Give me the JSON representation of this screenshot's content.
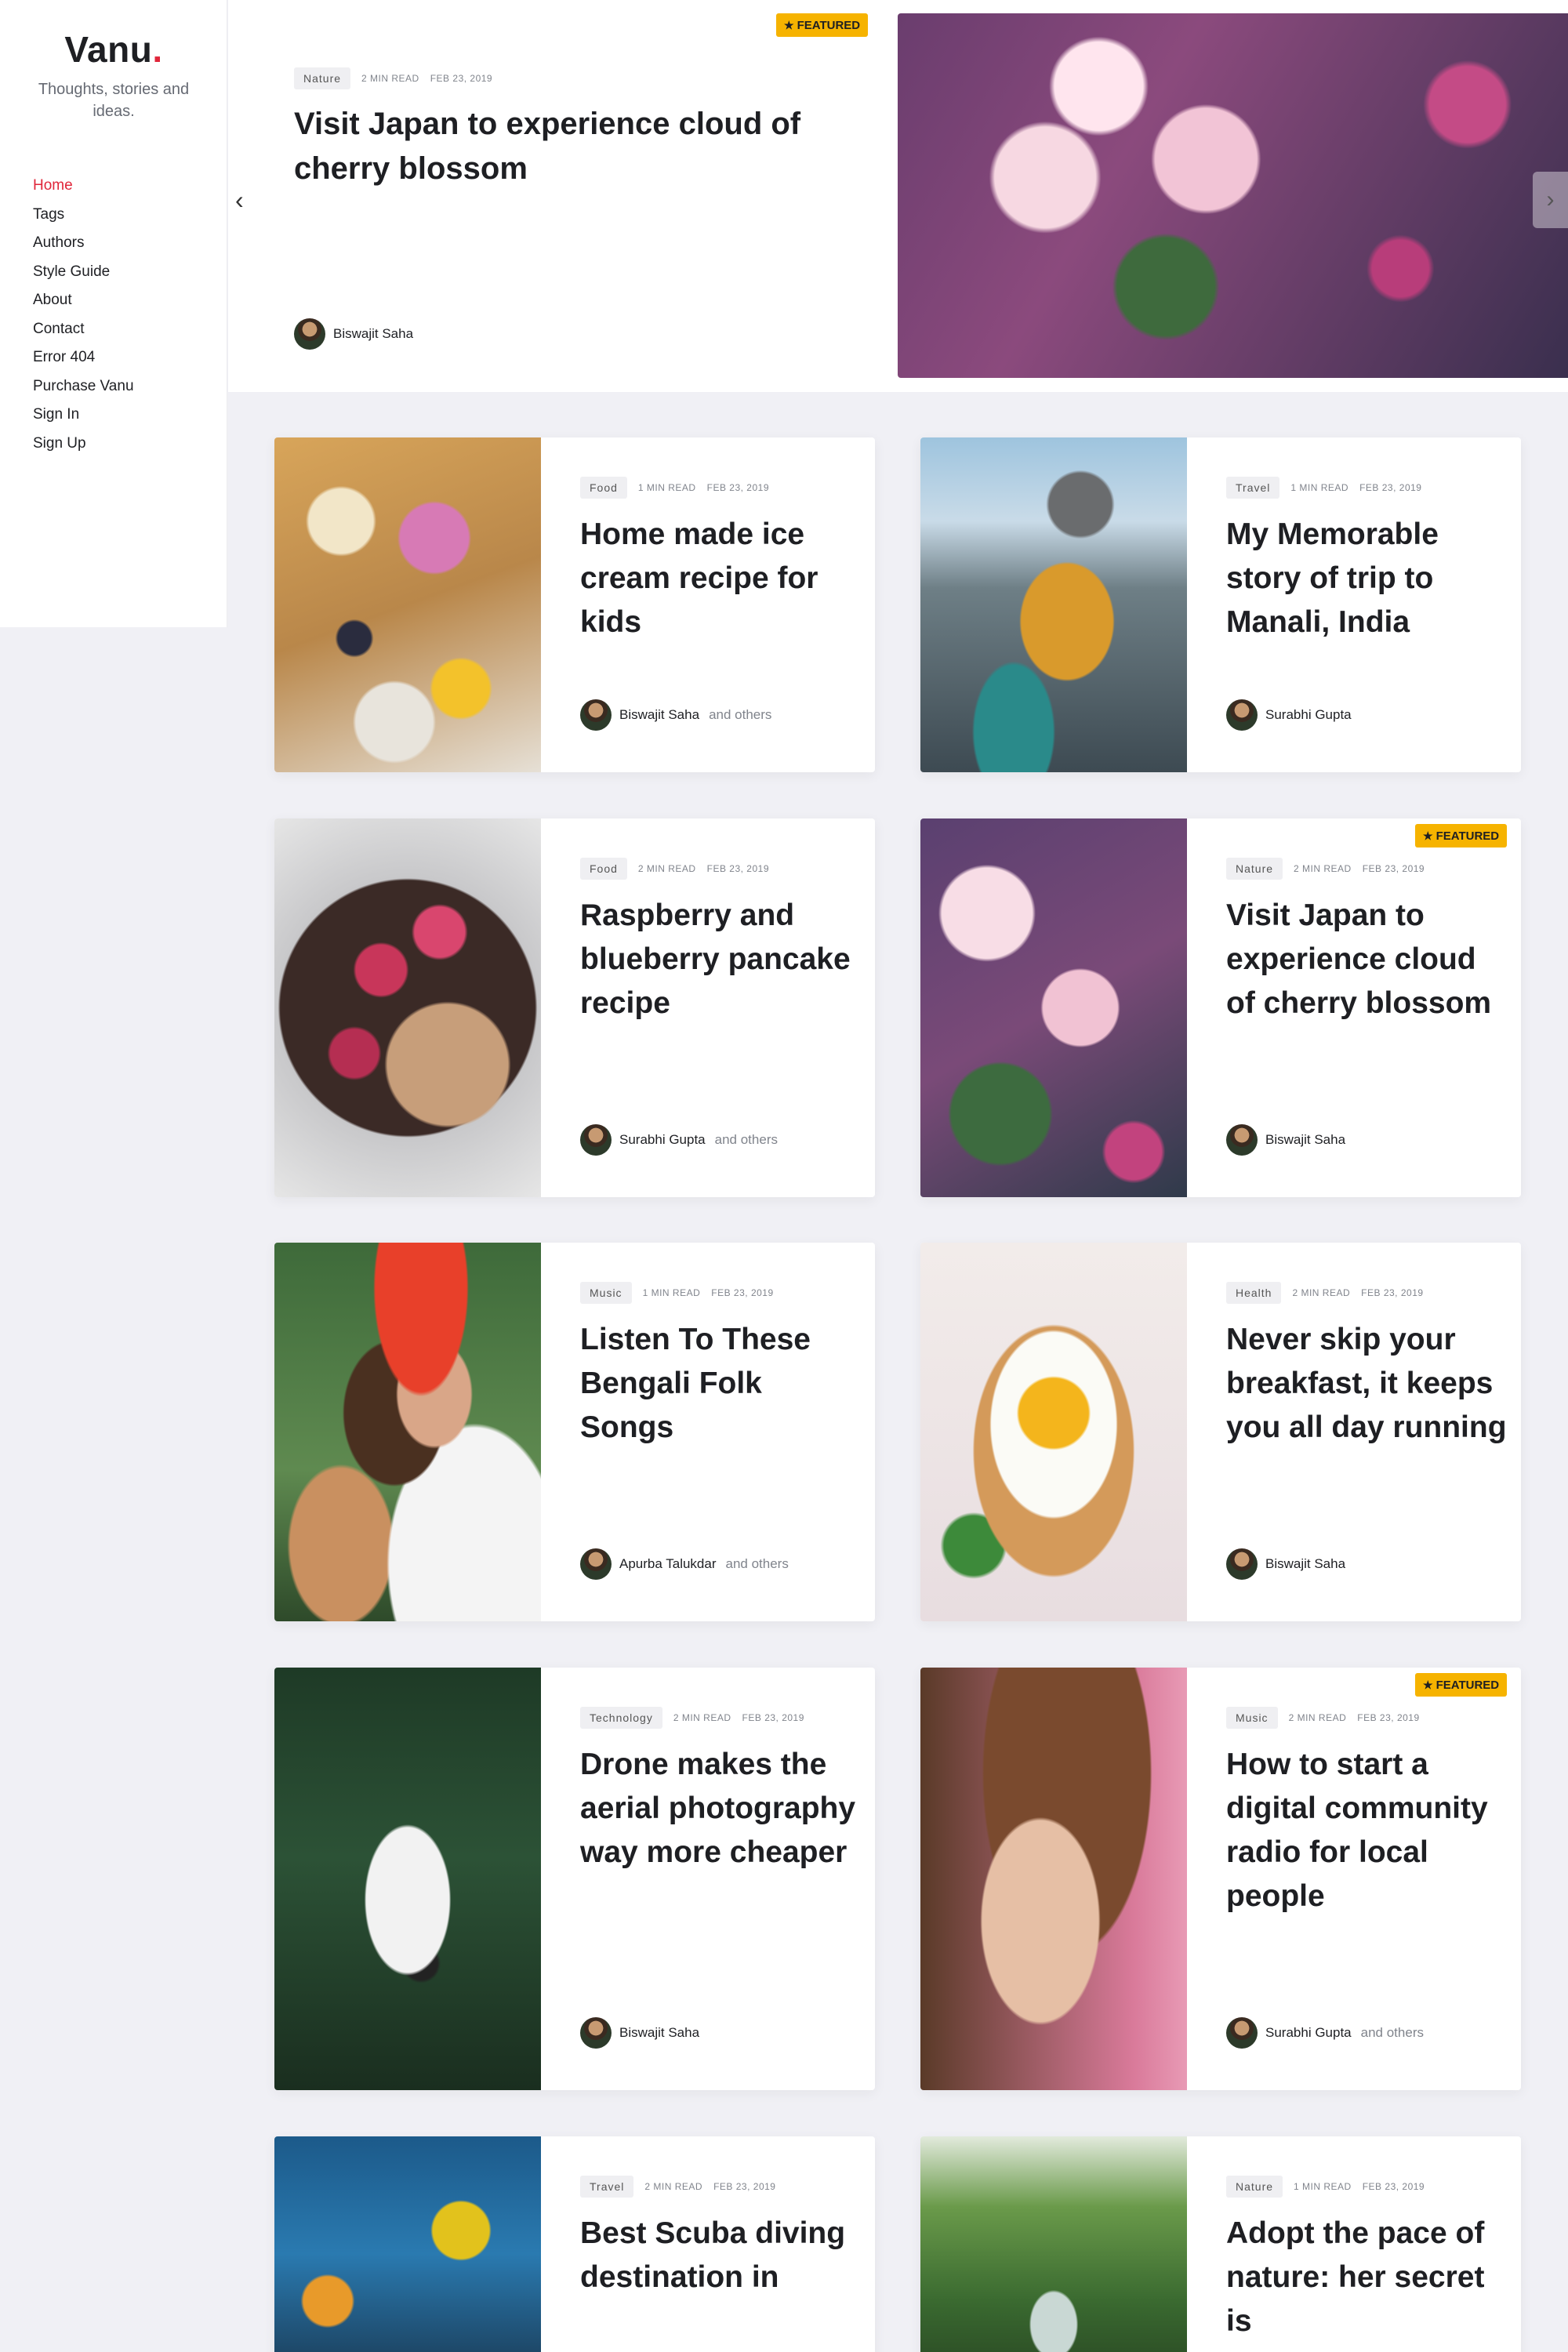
{
  "brand": {
    "name": "Vanu",
    "dot": ".",
    "tagline": "Thoughts, stories and ideas."
  },
  "nav": [
    {
      "label": "Home",
      "active": true
    },
    {
      "label": "Tags"
    },
    {
      "label": "Authors"
    },
    {
      "label": "Style Guide"
    },
    {
      "label": "About"
    },
    {
      "label": "Contact"
    },
    {
      "label": "Error 404"
    },
    {
      "label": "Purchase Vanu"
    },
    {
      "label": "Sign In"
    },
    {
      "label": "Sign Up"
    }
  ],
  "featured_label": "FEATURED",
  "hero": {
    "tag": "Nature",
    "read_time": "2 MIN READ",
    "date": "FEB 23, 2019",
    "title": "Visit Japan to experience cloud of cherry blossom",
    "author": "Biswajit Saha",
    "prev_icon": "chevron-left-icon",
    "next_icon": "chevron-right-icon"
  },
  "posts": [
    {
      "tag": "Food",
      "read_time": "1 MIN READ",
      "date": "FEB 23, 2019",
      "title": "Home made ice cream recipe for kids",
      "author": "Biswajit Saha",
      "others": "and others",
      "featured": false
    },
    {
      "tag": "Travel",
      "read_time": "1 MIN READ",
      "date": "FEB 23, 2019",
      "title": "My Memorable story of trip to Manali, India",
      "author": "Surabhi Gupta",
      "others": "",
      "featured": false
    },
    {
      "tag": "Food",
      "read_time": "2 MIN READ",
      "date": "FEB 23, 2019",
      "title": "Raspberry and blueberry pancake recipe",
      "author": "Surabhi Gupta",
      "others": "and others",
      "featured": false
    },
    {
      "tag": "Nature",
      "read_time": "2 MIN READ",
      "date": "FEB 23, 2019",
      "title": "Visit Japan to experience cloud of cherry blossom",
      "author": "Biswajit Saha",
      "others": "",
      "featured": true
    },
    {
      "tag": "Music",
      "read_time": "1 MIN READ",
      "date": "FEB 23, 2019",
      "title": "Listen To These Bengali Folk Songs",
      "author": "Apurba Talukdar",
      "others": "and others",
      "featured": false
    },
    {
      "tag": "Health",
      "read_time": "2 MIN READ",
      "date": "FEB 23, 2019",
      "title": "Never skip your breakfast, it keeps you all day running",
      "author": "Biswajit Saha",
      "others": "",
      "featured": false
    },
    {
      "tag": "Technology",
      "read_time": "2 MIN READ",
      "date": "FEB 23, 2019",
      "title": "Drone makes the aerial photography way more cheaper",
      "author": "Biswajit Saha",
      "others": "",
      "featured": false
    },
    {
      "tag": "Music",
      "read_time": "2 MIN READ",
      "date": "FEB 23, 2019",
      "title": "How to start a digital community radio for local people",
      "author": "Surabhi Gupta",
      "others": "and others",
      "featured": true
    },
    {
      "tag": "Travel",
      "read_time": "2 MIN READ",
      "date": "FEB 23, 2019",
      "title": "Best Scuba diving destination in",
      "author": "",
      "others": "",
      "featured": false
    },
    {
      "tag": "Nature",
      "read_time": "1 MIN READ",
      "date": "FEB 23, 2019",
      "title": "Adopt the pace of nature: her secret is",
      "author": "",
      "others": "",
      "featured": false
    }
  ],
  "colors": {
    "accent": "#e0263a",
    "featured": "#f6b300",
    "background": "#f0f0f5"
  }
}
